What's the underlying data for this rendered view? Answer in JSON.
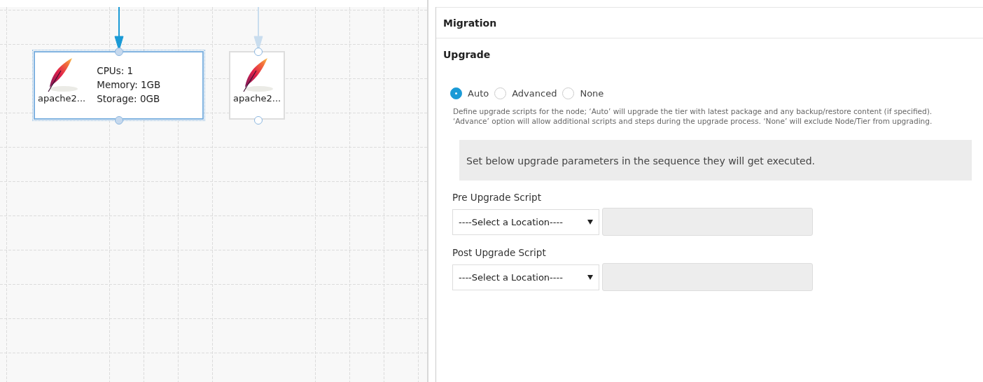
{
  "canvas": {
    "nodes": [
      {
        "label": "apache2...",
        "selected": true,
        "specs": [
          "CPUs: 1",
          "Memory: 1GB",
          "Storage: 0GB"
        ]
      },
      {
        "label": "apache2...",
        "selected": false
      }
    ]
  },
  "panel": {
    "sections": [
      {
        "title": "Migration"
      },
      {
        "title": "Upgrade"
      }
    ],
    "upgrade_mode": [
      {
        "label": "Auto",
        "selected": true
      },
      {
        "label": "Advanced",
        "selected": false
      },
      {
        "label": "None",
        "selected": false
      }
    ],
    "description": "Define upgrade scripts for the node; ‘Auto’ will upgrade the tier with latest package and any backup/restore content (if specified). ‘Advance’ option will allow additional scripts and steps during the upgrade process. ‘None’ will exclude Node/Tier from upgrading.",
    "info": "Set below upgrade parameters in the sequence they will get executed.",
    "scripts": [
      {
        "label": "Pre Upgrade Script",
        "location": "----Select a Location----"
      },
      {
        "label": "Post Upgrade Script",
        "location": "----Select a Location----"
      }
    ]
  }
}
